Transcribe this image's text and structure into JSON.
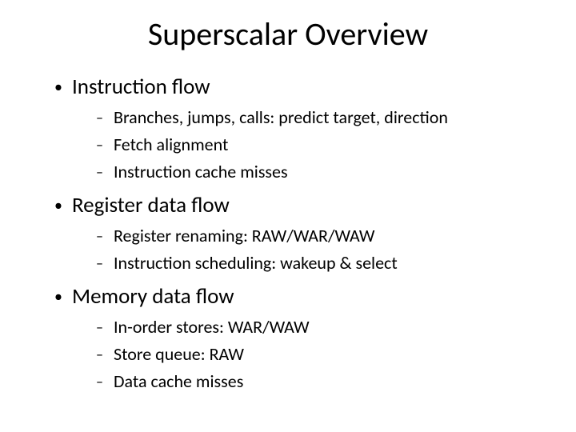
{
  "title": "Superscalar Overview",
  "sections": [
    {
      "heading": "Instruction flow",
      "items": [
        "Branches, jumps, calls: predict target, direction",
        "Fetch alignment",
        "Instruction cache misses"
      ]
    },
    {
      "heading": "Register data flow",
      "items": [
        "Register renaming: RAW/WAR/WAW",
        "Instruction scheduling: wakeup & select"
      ]
    },
    {
      "heading": "Memory data flow",
      "items": [
        "In-order stores: WAR/WAW",
        "Store queue: RAW",
        "Data cache misses"
      ]
    }
  ]
}
